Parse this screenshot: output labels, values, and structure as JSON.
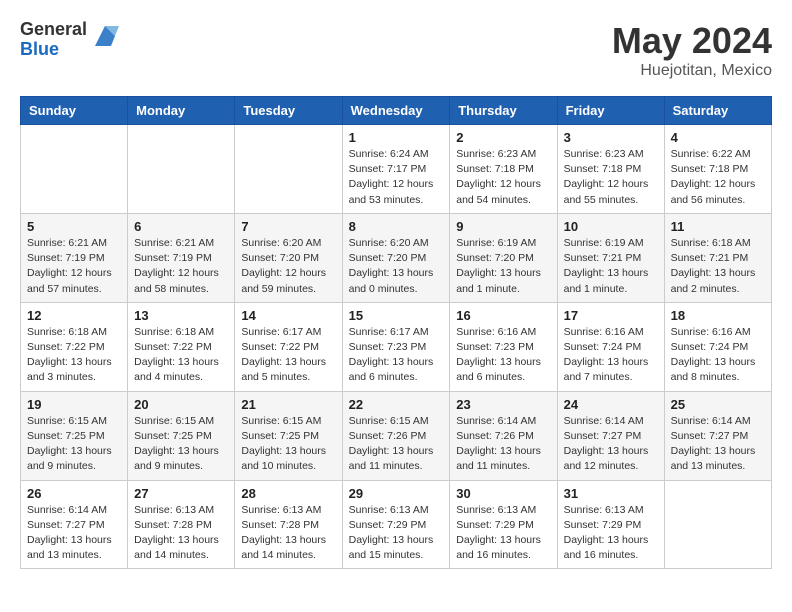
{
  "header": {
    "logo_general": "General",
    "logo_blue": "Blue",
    "month_title": "May 2024",
    "location": "Huejotitan, Mexico"
  },
  "days_of_week": [
    "Sunday",
    "Monday",
    "Tuesday",
    "Wednesday",
    "Thursday",
    "Friday",
    "Saturday"
  ],
  "weeks": [
    [
      {
        "day": "",
        "info": ""
      },
      {
        "day": "",
        "info": ""
      },
      {
        "day": "",
        "info": ""
      },
      {
        "day": "1",
        "info": "Sunrise: 6:24 AM\nSunset: 7:17 PM\nDaylight: 12 hours\nand 53 minutes."
      },
      {
        "day": "2",
        "info": "Sunrise: 6:23 AM\nSunset: 7:18 PM\nDaylight: 12 hours\nand 54 minutes."
      },
      {
        "day": "3",
        "info": "Sunrise: 6:23 AM\nSunset: 7:18 PM\nDaylight: 12 hours\nand 55 minutes."
      },
      {
        "day": "4",
        "info": "Sunrise: 6:22 AM\nSunset: 7:18 PM\nDaylight: 12 hours\nand 56 minutes."
      }
    ],
    [
      {
        "day": "5",
        "info": "Sunrise: 6:21 AM\nSunset: 7:19 PM\nDaylight: 12 hours\nand 57 minutes."
      },
      {
        "day": "6",
        "info": "Sunrise: 6:21 AM\nSunset: 7:19 PM\nDaylight: 12 hours\nand 58 minutes."
      },
      {
        "day": "7",
        "info": "Sunrise: 6:20 AM\nSunset: 7:20 PM\nDaylight: 12 hours\nand 59 minutes."
      },
      {
        "day": "8",
        "info": "Sunrise: 6:20 AM\nSunset: 7:20 PM\nDaylight: 13 hours\nand 0 minutes."
      },
      {
        "day": "9",
        "info": "Sunrise: 6:19 AM\nSunset: 7:20 PM\nDaylight: 13 hours\nand 1 minute."
      },
      {
        "day": "10",
        "info": "Sunrise: 6:19 AM\nSunset: 7:21 PM\nDaylight: 13 hours\nand 1 minute."
      },
      {
        "day": "11",
        "info": "Sunrise: 6:18 AM\nSunset: 7:21 PM\nDaylight: 13 hours\nand 2 minutes."
      }
    ],
    [
      {
        "day": "12",
        "info": "Sunrise: 6:18 AM\nSunset: 7:22 PM\nDaylight: 13 hours\nand 3 minutes."
      },
      {
        "day": "13",
        "info": "Sunrise: 6:18 AM\nSunset: 7:22 PM\nDaylight: 13 hours\nand 4 minutes."
      },
      {
        "day": "14",
        "info": "Sunrise: 6:17 AM\nSunset: 7:22 PM\nDaylight: 13 hours\nand 5 minutes."
      },
      {
        "day": "15",
        "info": "Sunrise: 6:17 AM\nSunset: 7:23 PM\nDaylight: 13 hours\nand 6 minutes."
      },
      {
        "day": "16",
        "info": "Sunrise: 6:16 AM\nSunset: 7:23 PM\nDaylight: 13 hours\nand 6 minutes."
      },
      {
        "day": "17",
        "info": "Sunrise: 6:16 AM\nSunset: 7:24 PM\nDaylight: 13 hours\nand 7 minutes."
      },
      {
        "day": "18",
        "info": "Sunrise: 6:16 AM\nSunset: 7:24 PM\nDaylight: 13 hours\nand 8 minutes."
      }
    ],
    [
      {
        "day": "19",
        "info": "Sunrise: 6:15 AM\nSunset: 7:25 PM\nDaylight: 13 hours\nand 9 minutes."
      },
      {
        "day": "20",
        "info": "Sunrise: 6:15 AM\nSunset: 7:25 PM\nDaylight: 13 hours\nand 9 minutes."
      },
      {
        "day": "21",
        "info": "Sunrise: 6:15 AM\nSunset: 7:25 PM\nDaylight: 13 hours\nand 10 minutes."
      },
      {
        "day": "22",
        "info": "Sunrise: 6:15 AM\nSunset: 7:26 PM\nDaylight: 13 hours\nand 11 minutes."
      },
      {
        "day": "23",
        "info": "Sunrise: 6:14 AM\nSunset: 7:26 PM\nDaylight: 13 hours\nand 11 minutes."
      },
      {
        "day": "24",
        "info": "Sunrise: 6:14 AM\nSunset: 7:27 PM\nDaylight: 13 hours\nand 12 minutes."
      },
      {
        "day": "25",
        "info": "Sunrise: 6:14 AM\nSunset: 7:27 PM\nDaylight: 13 hours\nand 13 minutes."
      }
    ],
    [
      {
        "day": "26",
        "info": "Sunrise: 6:14 AM\nSunset: 7:27 PM\nDaylight: 13 hours\nand 13 minutes."
      },
      {
        "day": "27",
        "info": "Sunrise: 6:13 AM\nSunset: 7:28 PM\nDaylight: 13 hours\nand 14 minutes."
      },
      {
        "day": "28",
        "info": "Sunrise: 6:13 AM\nSunset: 7:28 PM\nDaylight: 13 hours\nand 14 minutes."
      },
      {
        "day": "29",
        "info": "Sunrise: 6:13 AM\nSunset: 7:29 PM\nDaylight: 13 hours\nand 15 minutes."
      },
      {
        "day": "30",
        "info": "Sunrise: 6:13 AM\nSunset: 7:29 PM\nDaylight: 13 hours\nand 16 minutes."
      },
      {
        "day": "31",
        "info": "Sunrise: 6:13 AM\nSunset: 7:29 PM\nDaylight: 13 hours\nand 16 minutes."
      },
      {
        "day": "",
        "info": ""
      }
    ]
  ]
}
